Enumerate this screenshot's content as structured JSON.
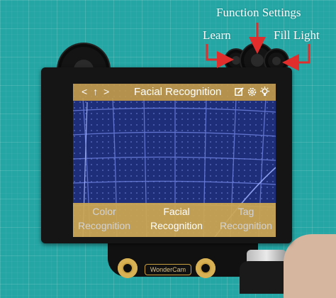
{
  "annotations": {
    "function_settings": "Function Settings",
    "learn": "Learn",
    "fill_light": "Fill Light",
    "color": "#e22d2d"
  },
  "device": {
    "brand_text": "WonderCam"
  },
  "screen": {
    "nav_glyphs": "< ↑ >",
    "title": "Facial Recognition",
    "icons": [
      "learn-edit-icon",
      "settings-gear-icon",
      "fill-light-bulb-icon"
    ],
    "options": [
      {
        "line1": "Color",
        "line2": "Recognition",
        "state": "inactive"
      },
      {
        "line1": "Facial",
        "line2": "Recognition",
        "state": "active"
      },
      {
        "line1": "Tag",
        "line2": "Recognition",
        "state": "inactive"
      }
    ],
    "accent_color": "#c9a048"
  }
}
